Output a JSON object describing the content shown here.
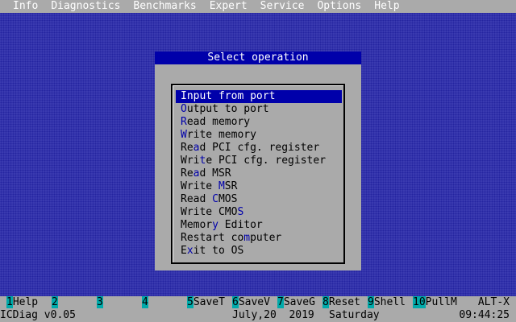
{
  "menu": [
    "Info",
    "Diagnostics",
    "Benchmarks",
    "Expert",
    "Service",
    "Options",
    "Help"
  ],
  "dialog": {
    "title": "Select operation",
    "selected_index": 0,
    "items": [
      {
        "pre": "",
        "key": "I",
        "post": "nput from port"
      },
      {
        "pre": "",
        "key": "O",
        "post": "utput to port"
      },
      {
        "pre": "",
        "key": "R",
        "post": "ead memory"
      },
      {
        "pre": "",
        "key": "W",
        "post": "rite memory"
      },
      {
        "pre": "Re",
        "key": "a",
        "post": "d PCI cfg. register"
      },
      {
        "pre": "Wri",
        "key": "t",
        "post": "e PCI cfg. register"
      },
      {
        "pre": "Re",
        "key": "a",
        "post": "d MSR"
      },
      {
        "pre": "Write ",
        "key": "M",
        "post": "SR"
      },
      {
        "pre": "Read ",
        "key": "C",
        "post": "MOS"
      },
      {
        "pre": "Write CMO",
        "key": "S",
        "post": ""
      },
      {
        "pre": "Memor",
        "key": "y",
        "post": " Editor"
      },
      {
        "pre": "Restart co",
        "key": "m",
        "post": "puter"
      },
      {
        "pre": "E",
        "key": "x",
        "post": "it to OS"
      }
    ]
  },
  "fkeys": [
    {
      "num": "1",
      "label": "Help"
    },
    {
      "num": "2",
      "label": ""
    },
    {
      "num": "3",
      "label": ""
    },
    {
      "num": "4",
      "label": ""
    },
    {
      "num": "5",
      "label": "SaveT"
    },
    {
      "num": "6",
      "label": "SaveV"
    },
    {
      "num": "7",
      "label": "SaveG"
    },
    {
      "num": "8",
      "label": "Reset"
    },
    {
      "num": "9",
      "label": "Shell"
    },
    {
      "num": "10",
      "label": "PullM"
    }
  ],
  "alt_key": "ALT-X",
  "status": {
    "app_version": "ICDiag v0.05",
    "date": "July,20  2019",
    "weekday": "Saturday",
    "time": "09:44:25"
  }
}
